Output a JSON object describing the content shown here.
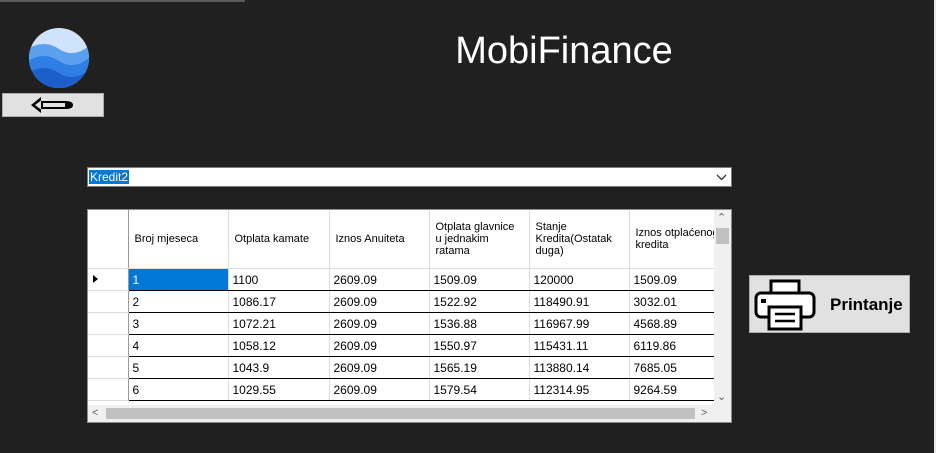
{
  "app": {
    "title": "MobiFinance"
  },
  "navigation": {
    "back_icon": "back-arrow-icon"
  },
  "loan_selector": {
    "value": "Kredit2"
  },
  "grid": {
    "columns": [
      "Broj mjeseca",
      "Otplata kamate",
      "Iznos Anuiteta",
      "Otplata glavnice u jednakim ratama",
      "Stanje Kredita(Ostatak duga)",
      "Iznos otplaćenog kredita"
    ],
    "rows": [
      [
        "1",
        "1100",
        "2609.09",
        "1509.09",
        "120000",
        "1509.09"
      ],
      [
        "2",
        "1086.17",
        "2609.09",
        "1522.92",
        "118490.91",
        "3032.01"
      ],
      [
        "3",
        "1072.21",
        "2609.09",
        "1536.88",
        "116967.99",
        "4568.89"
      ],
      [
        "4",
        "1058.12",
        "2609.09",
        "1550.97",
        "115431.11",
        "6119.86"
      ],
      [
        "5",
        "1043.9",
        "2609.09",
        "1565.19",
        "113880.14",
        "7685.05"
      ],
      [
        "6",
        "1029.55",
        "2609.09",
        "1579.54",
        "112314.95",
        "9264.59"
      ]
    ]
  },
  "print_button": {
    "label": "Printanje",
    "icon": "printer-icon"
  }
}
